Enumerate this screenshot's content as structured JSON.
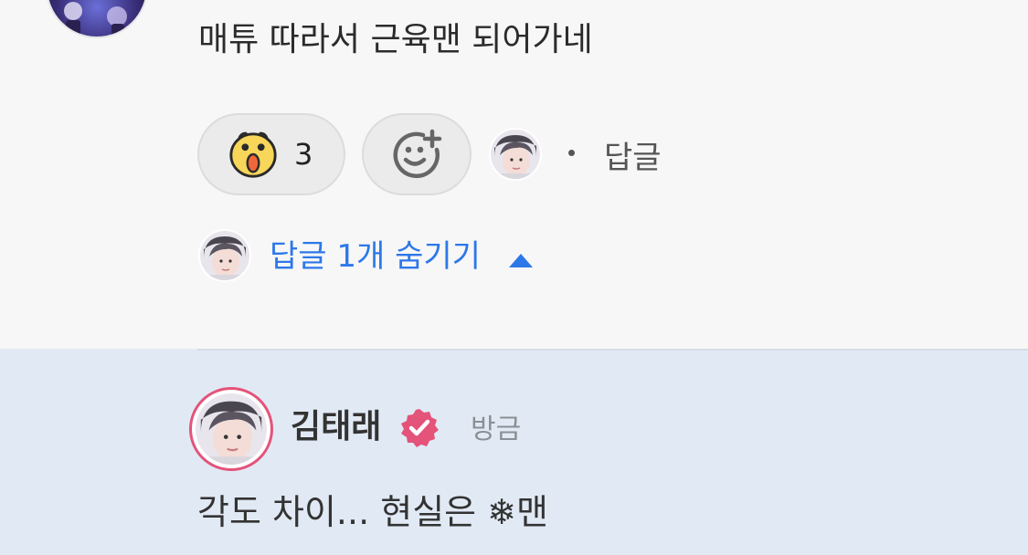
{
  "comment": {
    "text": "매튜 따라서 근육맨 되어가네"
  },
  "reactions": {
    "count": "3",
    "reaction_icon": "shocked-face-icon",
    "add_reaction_icon": "add-reaction-smile-icon",
    "reply_label": "답글"
  },
  "replies_toggle": {
    "label": "답글 1개 숨기기",
    "caret_icon": "caret-up-icon",
    "accent_color": "#2d78e8"
  },
  "reply": {
    "author": "김태래",
    "verified_icon": "verified-badge-icon",
    "verified_color": "#e4537a",
    "timestamp": "방금",
    "text": "각도 차이... 현실은 ❄맨",
    "highlight_color": "#e1eaf4"
  }
}
